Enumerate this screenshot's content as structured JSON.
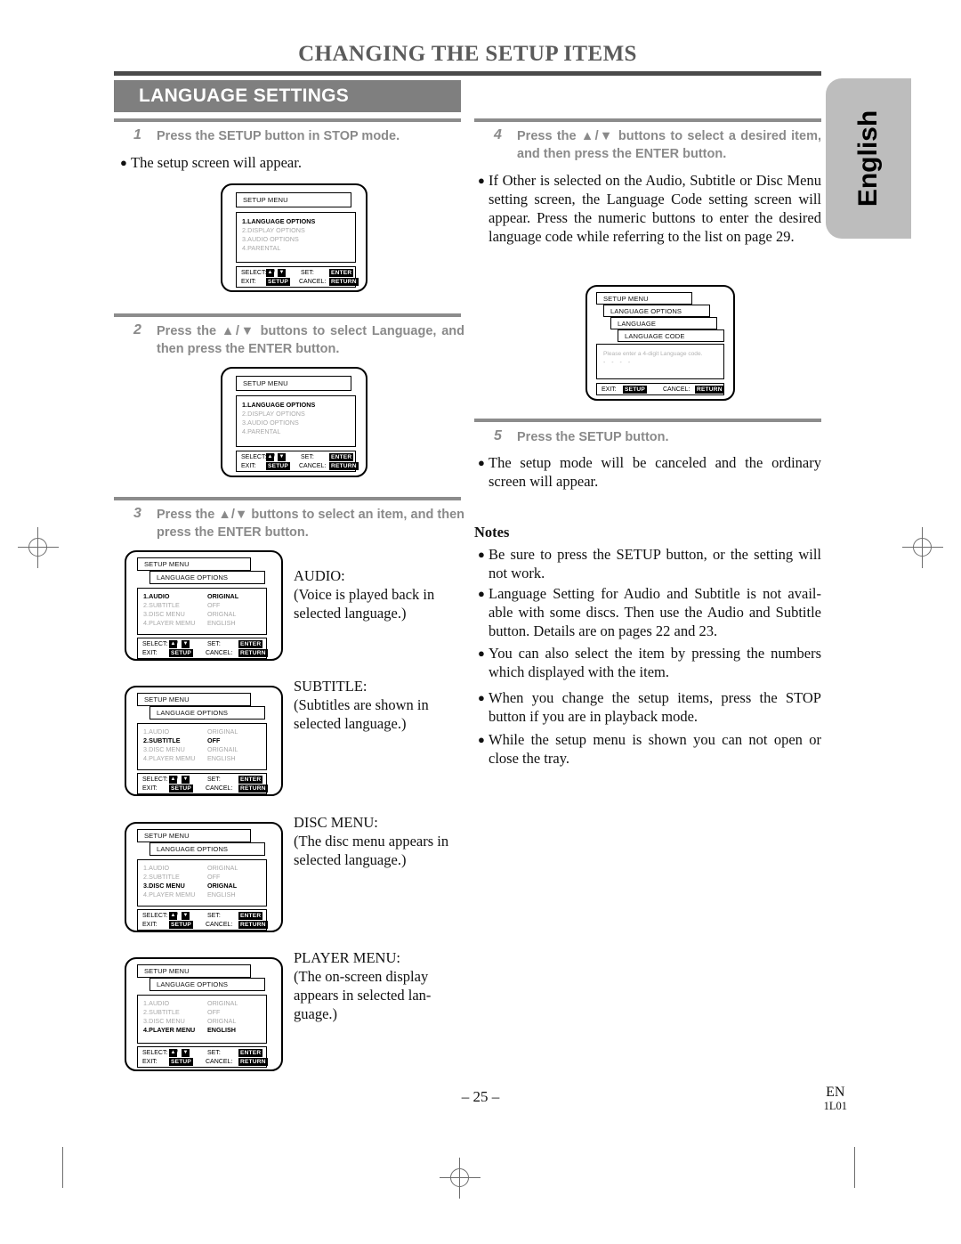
{
  "document": {
    "chapter_title": "CHANGING THE SETUP ITEMS",
    "section_title": "LANGUAGE SETTINGS",
    "side_tab": "English",
    "page_number": "– 25 –",
    "footer_region": "EN",
    "footer_code": "1L01"
  },
  "left_column": {
    "step1": {
      "number": "1",
      "text": "Press the SETUP button in STOP mode.",
      "bullet": "The setup screen will appear."
    },
    "step2": {
      "number": "2",
      "text": "Press the ▲/▼ buttons to select Language, and then press the ENTER button."
    },
    "step3": {
      "number": "3",
      "text": "Press the ▲/▼ buttons to select an item, and then press the ENTER button.",
      "items": [
        {
          "title": "AUDIO:",
          "desc": "(Voice is played back in selected language.)"
        },
        {
          "title": "SUBTITLE:",
          "desc": "(Subtitles are shown in selected language.)"
        },
        {
          "title": "DISC MENU:",
          "desc": "(The disc menu appears in selected language.)"
        },
        {
          "title": "PLAYER MENU:",
          "desc": "(The on-screen display appears in selected lan-guage.)"
        }
      ]
    }
  },
  "right_column": {
    "step4": {
      "number": "4",
      "text": "Press the ▲/▼ buttons to select a desired item, and then press the ENTER button.",
      "bullet": "If Other is selected on the Audio, Subtitle or Disc Menu setting screen, the Language Code setting screen will appear. Press the numeric buttons to enter the desired language code while referring to the list on page 29."
    },
    "step5": {
      "number": "5",
      "text": "Press the SETUP button.",
      "bullet": "The setup mode will be canceled and the ordinary screen will appear."
    },
    "notes": {
      "heading": "Notes",
      "items": [
        "Be sure to press the SETUP button, or the setting will not work.",
        "Language Setting for Audio and Subtitle is not avail-able with some discs. Then use the Audio and Subtitle button. Details are on pages 22 and 23.",
        "You can also select the item by pressing the numbers which displayed with the item.",
        "When you change the setup items, press the STOP button if you are in playback mode.",
        "While the setup menu is shown you can not open or close the tray."
      ]
    }
  },
  "osd_common": {
    "select_label": "SELECT:",
    "set_label": "SET:",
    "exit_label": "EXIT:",
    "cancel_label": "CANCEL:",
    "up_arrow": "▲",
    "down_arrow": "▼",
    "slash": "/",
    "key_enter": "ENTER",
    "key_setup": "SETUP",
    "key_return": "RETURN"
  },
  "osd_screens": {
    "setup_menu_1": {
      "title": "SETUP MENU",
      "rows": [
        {
          "label": "1.LANGUAGE OPTIONS",
          "state": "on"
        },
        {
          "label": "2.DISPLAY OPTIONS",
          "state": "dim"
        },
        {
          "label": "3.AUDIO OPTIONS",
          "state": "dim"
        },
        {
          "label": "4.PARENTAL",
          "state": "dim"
        }
      ]
    },
    "setup_menu_2": {
      "title": "SETUP  MENU",
      "rows": [
        {
          "label": "1.LANGUAGE OPTIONS",
          "state": "on"
        },
        {
          "label": "2.DISPLAY OPTIONS",
          "state": "dim"
        },
        {
          "label": "3.AUDIO OPTIONS",
          "state": "dim"
        },
        {
          "label": "4.PARENTAL",
          "state": "dim"
        }
      ]
    },
    "language_audio": {
      "title": "SETUP MENU",
      "subtitle": "LANGUAGE OPTIONS",
      "rows": [
        {
          "label": "1.AUDIO",
          "value": "ORIGINAL",
          "state": "on"
        },
        {
          "label": "2.SUBTITLE",
          "value": "OFF",
          "state": "dim"
        },
        {
          "label": "3.DISC MENU",
          "value": "ORIGNAL",
          "state": "dim"
        },
        {
          "label": "4.PLAYER MEMU",
          "value": "ENGLISH",
          "state": "dim"
        }
      ]
    },
    "language_subtitle": {
      "title": "SETUP MENU",
      "subtitle": "LANGUAGE OPTIONS",
      "rows": [
        {
          "label": "1.AUDIO",
          "value": "ORIGINAL",
          "state": "dim"
        },
        {
          "label": "2.SUBTITLE",
          "value": "OFF",
          "state": "on"
        },
        {
          "label": "3.DISC MENU",
          "value": "ORIGNAIL",
          "state": "dim"
        },
        {
          "label": "4.PLAYER MEMU",
          "value": "ENGLISH",
          "state": "dim"
        }
      ]
    },
    "language_disc_menu": {
      "title": "SETUP MENU",
      "subtitle": "LANGUAGE OPTIONS",
      "rows": [
        {
          "label": "1.AUDIO",
          "value": "ORIGINAL",
          "state": "dim"
        },
        {
          "label": "2.SUBTITLE",
          "value": "OFF",
          "state": "dim"
        },
        {
          "label": "3.DISC MENU",
          "value": "ORIGNAL",
          "state": "on"
        },
        {
          "label": "4.PLAYER MEMU",
          "value": "ENGLISH",
          "state": "dim"
        }
      ]
    },
    "language_player_menu": {
      "title": "SETUP MENU",
      "subtitle": "LANGUAGE OPTIONS",
      "rows": [
        {
          "label": "1.AUDIO",
          "value": "ORIGINAL",
          "state": "dim"
        },
        {
          "label": "2.SUBTITLE",
          "value": "OFF",
          "state": "dim"
        },
        {
          "label": "3.DISC MENU",
          "value": "ORIGNAL",
          "state": "dim"
        },
        {
          "label": "4.PLAYER MENU",
          "value": "ENGLISH",
          "state": "on"
        }
      ]
    },
    "language_code": {
      "title": "SETUP MENU",
      "subtitle": "LANGUAGE OPTIONS",
      "subtitle2": "LANGUAGE",
      "subtitle3": "LANGUAGE CODE",
      "prompt": "Please enter a 4-digit Language code.",
      "dots": "- - - -"
    }
  }
}
